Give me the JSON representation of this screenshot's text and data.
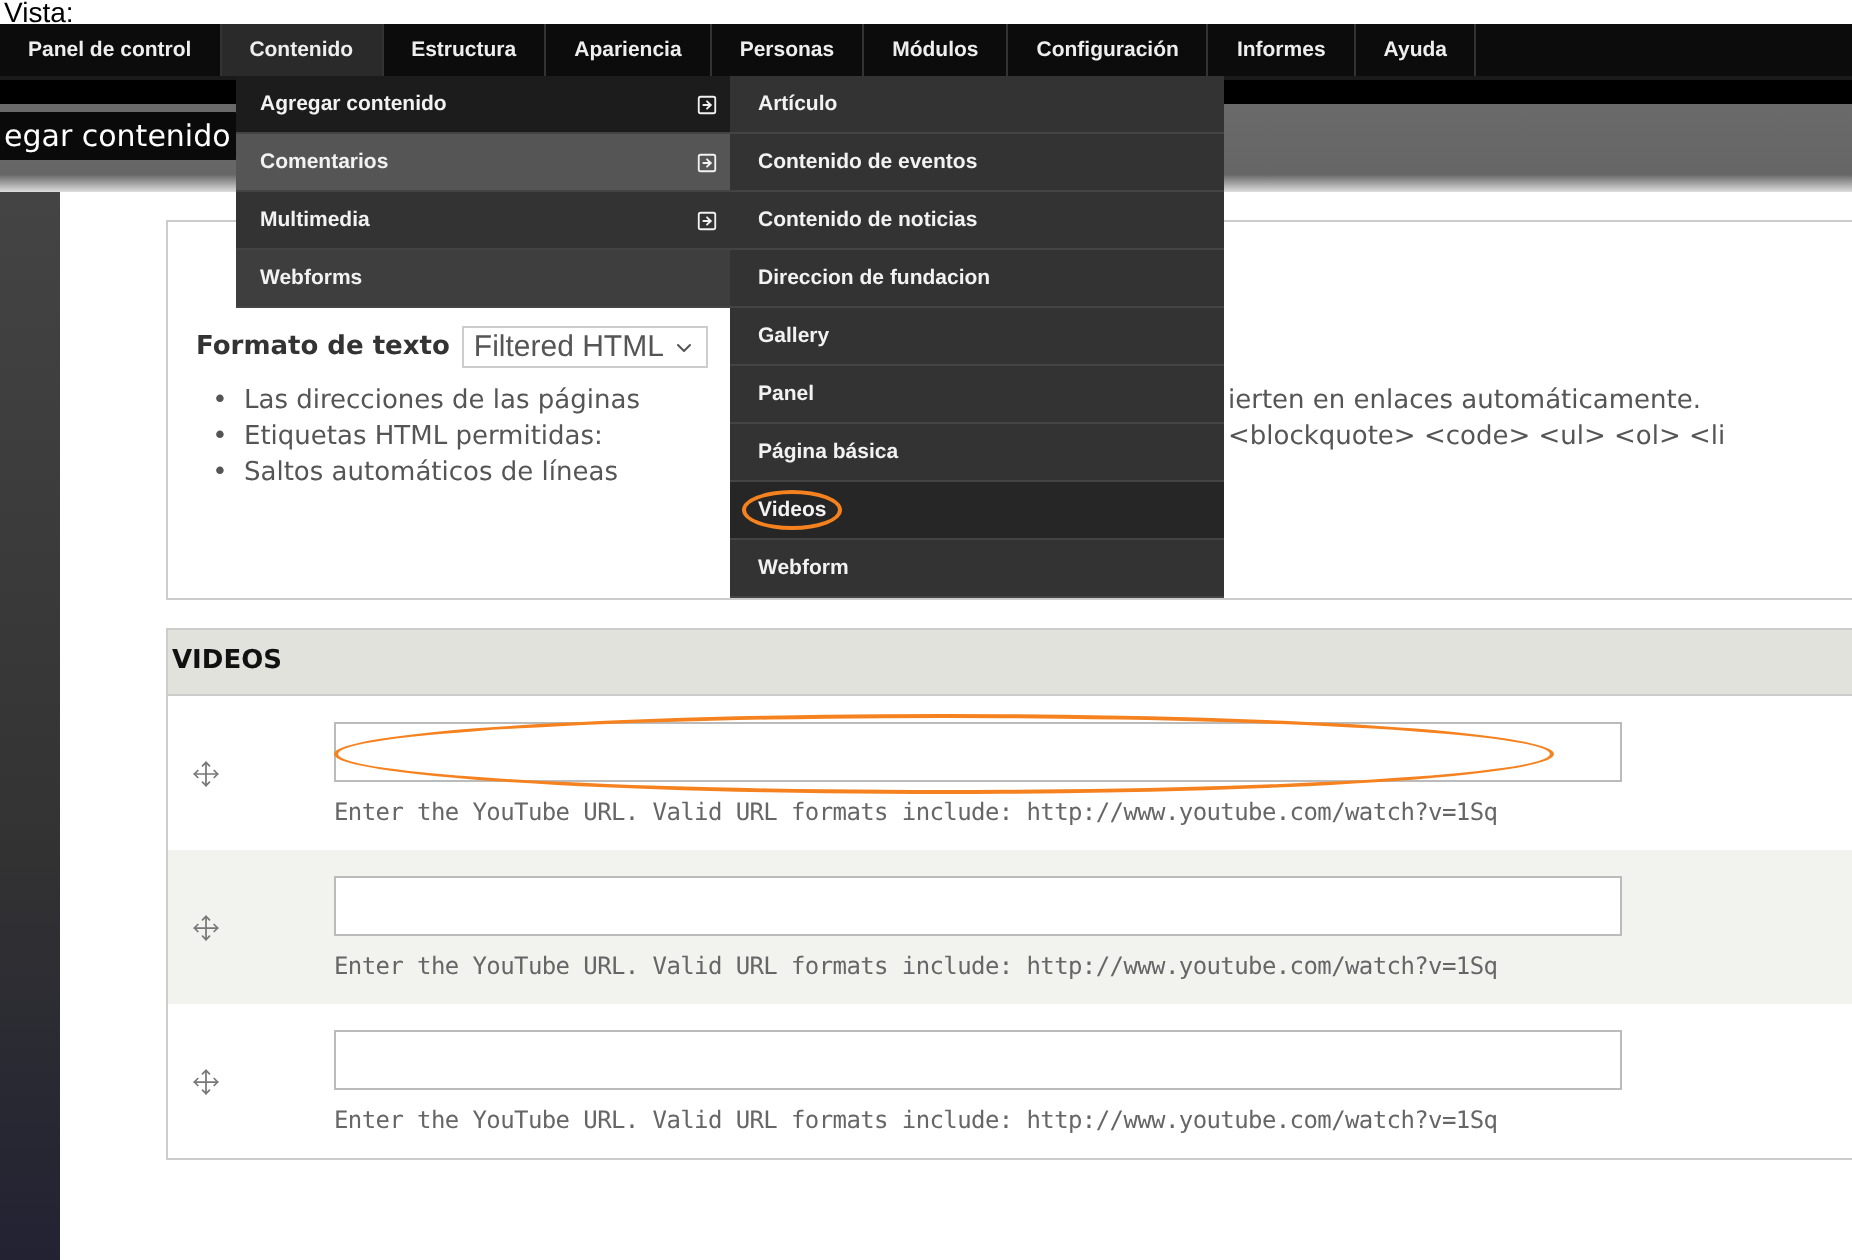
{
  "heading": "Vista:",
  "toolbar": [
    {
      "label": "Panel de control",
      "selected": false
    },
    {
      "label": "Contenido",
      "selected": true
    },
    {
      "label": "Estructura",
      "selected": false
    },
    {
      "label": "Apariencia",
      "selected": false
    },
    {
      "label": "Personas",
      "selected": false
    },
    {
      "label": "Módulos",
      "selected": false
    },
    {
      "label": "Configuración",
      "selected": false
    },
    {
      "label": "Informes",
      "selected": false
    },
    {
      "label": "Ayuda",
      "selected": false
    }
  ],
  "content_menu": [
    {
      "label": "Agregar contenido",
      "has_submenu": true,
      "expanded": true,
      "hovered": false
    },
    {
      "label": "Comentarios",
      "has_submenu": true,
      "expanded": false,
      "hovered": true
    },
    {
      "label": "Multimedia",
      "has_submenu": true,
      "expanded": false,
      "hovered": false
    },
    {
      "label": "Webforms",
      "has_submenu": false,
      "expanded": false,
      "hovered": false
    }
  ],
  "add_content_menu": [
    {
      "label": "Artículo",
      "circled": false
    },
    {
      "label": "Contenido de eventos",
      "circled": false
    },
    {
      "label": "Contenido de noticias",
      "circled": false
    },
    {
      "label": "Direccion de fundacion",
      "circled": false
    },
    {
      "label": "Gallery",
      "circled": false
    },
    {
      "label": "Panel",
      "circled": false
    },
    {
      "label": "Página básica",
      "circled": false
    },
    {
      "label": "Videos",
      "circled": true
    },
    {
      "label": "Webform",
      "circled": false
    }
  ],
  "tabs": [
    {
      "label": "egar contenido",
      "selected": true
    }
  ],
  "text_format": {
    "label": "Formato de texto",
    "value": "Filtered HTML",
    "tips": [
      {
        "marker": "•",
        "left": "Las direcciones de las páginas",
        "right": "ierten en enlaces automáticamente."
      },
      {
        "marker": "•",
        "left": "Etiquetas HTML permitidas:",
        "right": "<blockquote> <code> <ul> <ol> <li"
      },
      {
        "marker": "•",
        "left": "Saltos automáticos de líneas"
      }
    ]
  },
  "videos": {
    "title": "VIDEOS",
    "rows": [
      {
        "value": "",
        "help": "Enter the YouTube URL. Valid URL formats include: http://www.youtube.com/watch?v=1Sq",
        "circled": true
      },
      {
        "value": "",
        "help": "Enter the YouTube URL. Valid URL formats include: http://www.youtube.com/watch?v=1Sq",
        "circled": false
      },
      {
        "value": "",
        "help": "Enter the YouTube URL. Valid URL formats include: http://www.youtube.com/watch?v=1Sq",
        "circled": false
      }
    ]
  }
}
